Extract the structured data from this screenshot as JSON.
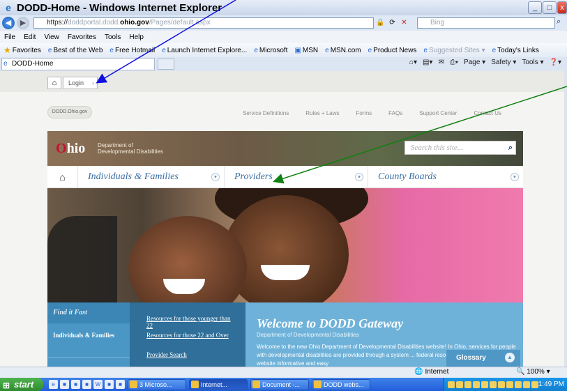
{
  "window": {
    "title": "DODD-Home - Windows Internet Explorer",
    "buttons": [
      "_",
      "□",
      "x"
    ]
  },
  "address_bar": {
    "prefix": "https://",
    "host_start": "doddportal.dodd.",
    "host_bold": "ohio.gov",
    "path": "/Pages/default.aspx",
    "search_placeholder": "Bing"
  },
  "menu": [
    "File",
    "Edit",
    "View",
    "Favorites",
    "Tools",
    "Help"
  ],
  "favorites_bar": {
    "label": "Favorites",
    "links": [
      "Best of the Web",
      "Free Hotmail",
      "Launch Internet Explore...",
      "Microsoft",
      "MSN",
      "MSN.com",
      "Product News",
      "Suggested Sites ▾",
      "Today's Links"
    ]
  },
  "tab": {
    "label": "DODD-Home"
  },
  "command_bar": [
    "Page ▾",
    "Safety ▾",
    "Tools ▾"
  ],
  "page": {
    "login_label": "Login",
    "crumb": "DODD.Ohio.gov",
    "top_nav": [
      "Service Definitions",
      "Rules + Laws",
      "Forms",
      "FAQs",
      "Support Center",
      "Contact Us"
    ],
    "logo_main": "hio",
    "logo_o": "O",
    "logo_sub_1": "Department of",
    "logo_sub_2": "Developmental Disabilities",
    "site_search_placeholder": "Search this site...",
    "main_nav": [
      "Individuals & Families",
      "Providers",
      "County Boards"
    ],
    "find_it_fast": "Find it Fast",
    "fif_item": "Individuals & Families",
    "fif_links": [
      "Resources for those younger than 22",
      "Resources for those 22 and Over",
      "Provider Search"
    ],
    "welcome_title": "Welcome to DODD Gateway",
    "welcome_sub": "Department of Developmental Disabilities",
    "welcome_body": "Welcome to the new Ohio Department of Developmental Disabilities website! In Ohio, services for people with developmental disabilities are provided through a system ... federal resources. We strive to make this website informative and easy",
    "glossary": "Glossary"
  },
  "status_bar": {
    "zone": "Internet",
    "zoom": "100%"
  },
  "taskbar": {
    "start": "start",
    "tasks": [
      "3 Microso...",
      "Internet...",
      "Document -...",
      "DODD webs..."
    ],
    "clock": "1:49 PM"
  },
  "colors": {
    "ohio_red": "#c8102e",
    "nav_blue": "#3a6ea5",
    "arrow_blue": "#1010e0",
    "arrow_green": "#108010"
  }
}
